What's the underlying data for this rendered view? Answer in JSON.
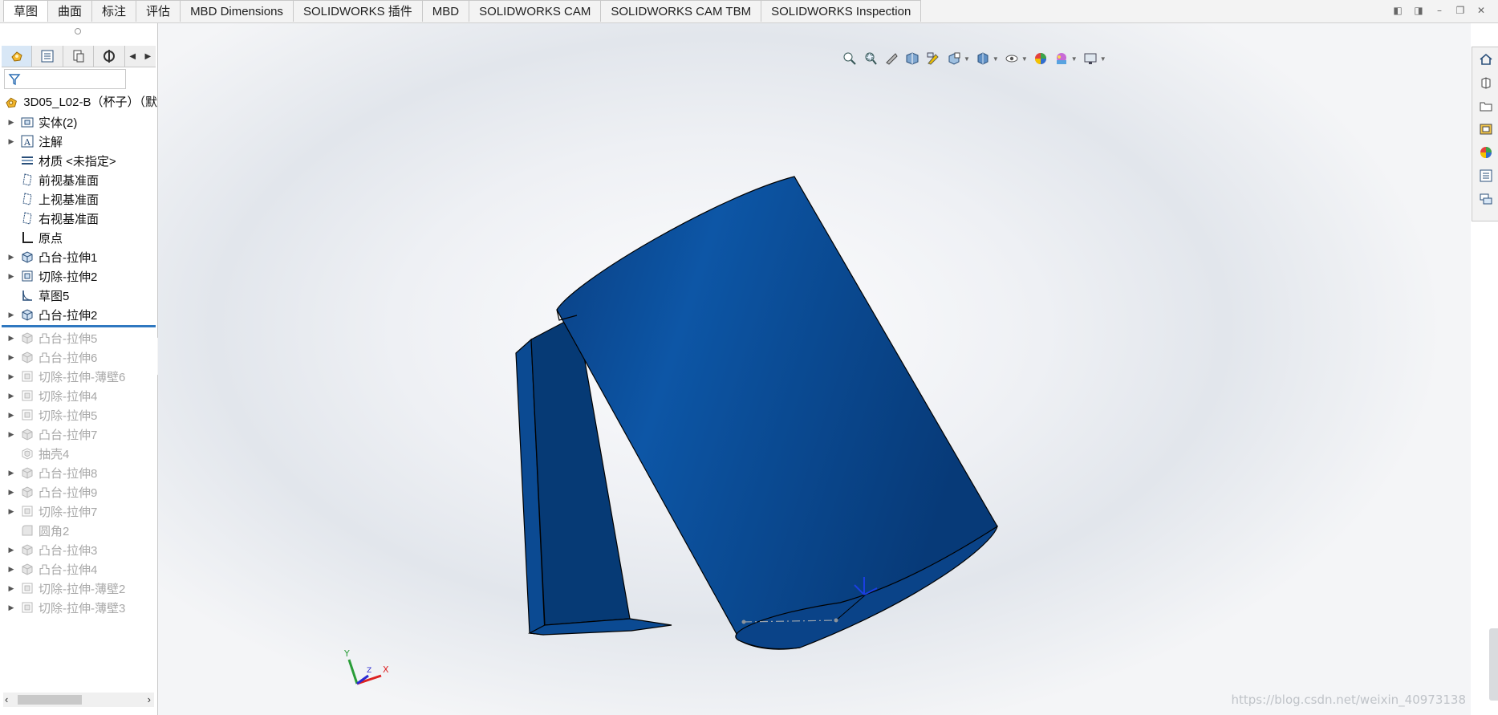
{
  "tabs": [
    "草图",
    "曲面",
    "标注",
    "评估",
    "MBD Dimensions",
    "SOLIDWORKS 插件",
    "MBD",
    "SOLIDWORKS CAM",
    "SOLIDWORKS CAM TBM",
    "SOLIDWORKS Inspection"
  ],
  "active_tab": "草图",
  "window_controls": [
    "pane-left-icon",
    "pane-right-icon",
    "minimize-icon",
    "restore-icon",
    "close-icon"
  ],
  "feature_manager": {
    "tabs": [
      "feature-manager-icon",
      "property-manager-icon",
      "configuration-manager-icon",
      "dimxpert-icon"
    ],
    "root": "3D05_L02-B（杯子）（默",
    "items": [
      {
        "label": "实体(2)",
        "icon": "solid-bodies-icon",
        "expandable": true,
        "suppressed": false
      },
      {
        "label": "注解",
        "icon": "annotations-icon",
        "expandable": true,
        "suppressed": false
      },
      {
        "label": "材质 <未指定>",
        "icon": "material-icon",
        "expandable": false,
        "suppressed": false
      },
      {
        "label": "前视基准面",
        "icon": "plane-icon",
        "expandable": false,
        "suppressed": false
      },
      {
        "label": "上视基准面",
        "icon": "plane-icon",
        "expandable": false,
        "suppressed": false
      },
      {
        "label": "右视基准面",
        "icon": "plane-icon",
        "expandable": false,
        "suppressed": false
      },
      {
        "label": "原点",
        "icon": "origin-icon",
        "expandable": false,
        "suppressed": false
      },
      {
        "label": "凸台-拉伸1",
        "icon": "boss-extrude-icon",
        "expandable": true,
        "suppressed": false
      },
      {
        "label": "切除-拉伸2",
        "icon": "cut-extrude-icon",
        "expandable": true,
        "suppressed": false
      },
      {
        "label": "草图5",
        "icon": "sketch-icon",
        "expandable": false,
        "suppressed": false
      },
      {
        "label": "凸台-拉伸2",
        "icon": "boss-extrude-icon",
        "expandable": true,
        "suppressed": false
      },
      {
        "label": "凸台-拉伸5",
        "icon": "boss-extrude-icon",
        "expandable": true,
        "suppressed": true
      },
      {
        "label": "凸台-拉伸6",
        "icon": "boss-extrude-icon",
        "expandable": true,
        "suppressed": true
      },
      {
        "label": "切除-拉伸-薄壁6",
        "icon": "cut-extrude-icon",
        "expandable": true,
        "suppressed": true
      },
      {
        "label": "切除-拉伸4",
        "icon": "cut-extrude-icon",
        "expandable": true,
        "suppressed": true
      },
      {
        "label": "切除-拉伸5",
        "icon": "cut-extrude-icon",
        "expandable": true,
        "suppressed": true
      },
      {
        "label": "凸台-拉伸7",
        "icon": "boss-extrude-icon",
        "expandable": true,
        "suppressed": true
      },
      {
        "label": "抽壳4",
        "icon": "shell-icon",
        "expandable": false,
        "suppressed": true
      },
      {
        "label": "凸台-拉伸8",
        "icon": "boss-extrude-icon",
        "expandable": true,
        "suppressed": true
      },
      {
        "label": "凸台-拉伸9",
        "icon": "boss-extrude-icon",
        "expandable": true,
        "suppressed": true
      },
      {
        "label": "切除-拉伸7",
        "icon": "cut-extrude-icon",
        "expandable": true,
        "suppressed": true
      },
      {
        "label": "圆角2",
        "icon": "fillet-icon",
        "expandable": false,
        "suppressed": true
      },
      {
        "label": "凸台-拉伸3",
        "icon": "boss-extrude-icon",
        "expandable": true,
        "suppressed": true
      },
      {
        "label": "凸台-拉伸4",
        "icon": "boss-extrude-icon",
        "expandable": true,
        "suppressed": true
      },
      {
        "label": "切除-拉伸-薄壁2",
        "icon": "cut-extrude-icon",
        "expandable": true,
        "suppressed": true
      },
      {
        "label": "切除-拉伸-薄壁3",
        "icon": "cut-extrude-icon",
        "expandable": true,
        "suppressed": true
      }
    ],
    "rollback_after_index": 10
  },
  "heads_up_toolbar": [
    "zoom-to-fit-icon",
    "zoom-area-icon",
    "previous-view-icon",
    "section-view-icon",
    "dynamic-annotation-icon",
    "view-orientation-icon",
    "display-style-icon",
    "hide-show-icon",
    "edit-appearance-icon",
    "apply-scene-icon",
    "view-settings-icon"
  ],
  "task_pane": [
    "home-icon",
    "resources-icon",
    "file-explorer-icon",
    "view-palette-icon",
    "appearances-icon",
    "custom-properties-icon",
    "forum-icon"
  ],
  "triad": {
    "x": "X",
    "y": "Y",
    "z": "Z"
  },
  "watermark": "https://blog.csdn.net/weixin_40973138",
  "colors": {
    "model": "#0b4a92",
    "model_dark": "#063a75",
    "accent": "#2f78c0"
  }
}
